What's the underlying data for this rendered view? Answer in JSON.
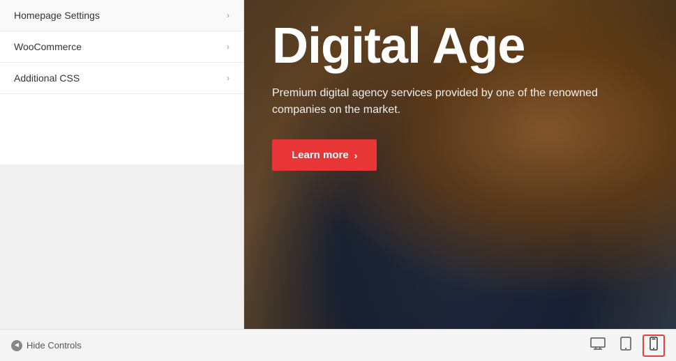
{
  "sidebar": {
    "items": [
      {
        "id": "homepage-settings",
        "label": "Homepage Settings",
        "has_arrow": true
      },
      {
        "id": "woocommerce",
        "label": "WooCommerce",
        "has_arrow": true
      },
      {
        "id": "additional-css",
        "label": "Additional CSS",
        "has_arrow": true
      }
    ]
  },
  "bottom_bar": {
    "hide_controls_label": "Hide Controls",
    "devices": [
      {
        "id": "desktop",
        "icon": "🖥",
        "label": "Desktop"
      },
      {
        "id": "tablet",
        "icon": "▭",
        "label": "Tablet"
      },
      {
        "id": "mobile",
        "icon": "📱",
        "label": "Mobile",
        "active": true
      }
    ]
  },
  "preview": {
    "title": "Digital Age",
    "subtitle": "Premium digital agency services provided by one of the renowned companies on the market.",
    "cta_label": "Learn more",
    "cta_arrow": "›"
  }
}
